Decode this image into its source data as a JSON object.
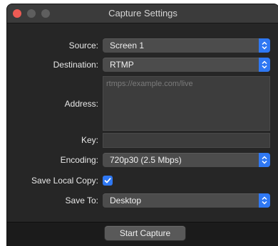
{
  "window": {
    "title": "Capture Settings"
  },
  "form": {
    "source": {
      "label": "Source:",
      "value": "Screen 1"
    },
    "destination": {
      "label": "Destination:",
      "value": "RTMP"
    },
    "address": {
      "label": "Address:",
      "value": "",
      "placeholder": "rtmps://example.com/live"
    },
    "key": {
      "label": "Key:",
      "value": ""
    },
    "encoding": {
      "label": "Encoding:",
      "value": "720p30 (2.5 Mbps)"
    },
    "save_local_copy": {
      "label": "Save Local Copy:",
      "checked": true
    },
    "save_to": {
      "label": "Save To:",
      "value": "Desktop"
    }
  },
  "actions": {
    "start_label": "Start Capture"
  },
  "colors": {
    "accent": "#2f78f3",
    "close": "#ee5b54",
    "window_bg": "#262626"
  },
  "icons": {
    "window_controls": [
      "close-icon",
      "minimize-icon",
      "zoom-icon"
    ],
    "popup_arrows": "chevron-up-down-icon",
    "checkbox": "checkmark-icon"
  }
}
